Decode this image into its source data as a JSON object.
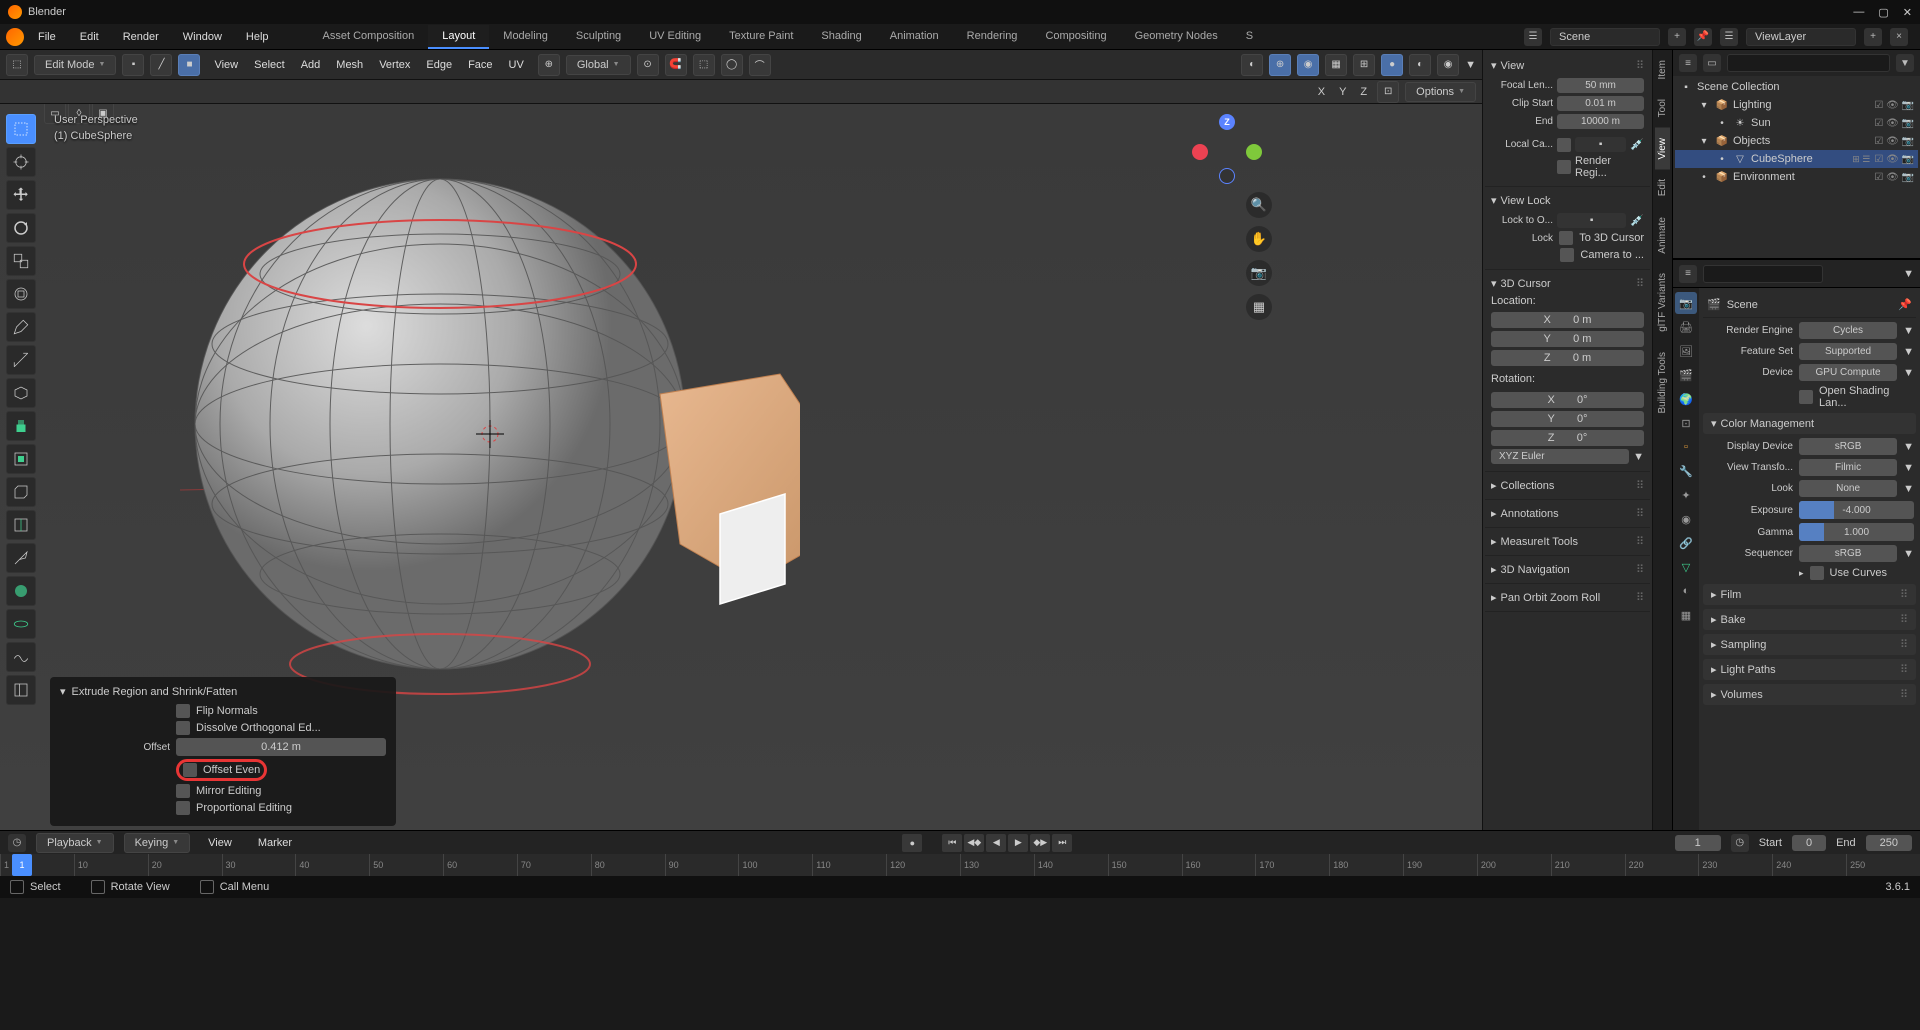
{
  "app": {
    "title": "Blender"
  },
  "menu": {
    "file": "File",
    "edit": "Edit",
    "render": "Render",
    "window": "Window",
    "help": "Help"
  },
  "workspaces": [
    "Asset Composition",
    "Layout",
    "Modeling",
    "Sculpting",
    "UV Editing",
    "Texture Paint",
    "Shading",
    "Animation",
    "Rendering",
    "Compositing",
    "Geometry Nodes",
    "S"
  ],
  "active_workspace": "Layout",
  "scene": {
    "name": "Scene",
    "layer": "ViewLayer"
  },
  "header3d": {
    "mode": "Edit Mode",
    "menus": [
      "View",
      "Select",
      "Add",
      "Mesh",
      "Vertex",
      "Edge",
      "Face",
      "UV"
    ],
    "orientation": "Global",
    "options": "Options"
  },
  "axes_header": [
    "X",
    "Y",
    "Z"
  ],
  "overlay": {
    "line1": "User Perspective",
    "line2": "(1) CubeSphere"
  },
  "op_panel": {
    "title": "Extrude Region and Shrink/Fatten",
    "flip_normals": "Flip Normals",
    "dissolve": "Dissolve Orthogonal Ed...",
    "offset_label": "Offset",
    "offset_value": "0.412 m",
    "offset_even": "Offset Even",
    "mirror": "Mirror Editing",
    "proportional": "Proportional Editing"
  },
  "npanel": {
    "tabs": [
      "Item",
      "Tool",
      "View",
      "Edit",
      "Animate",
      "glTF Variants",
      "Building Tools"
    ],
    "active_tab": "View",
    "view": {
      "title": "View",
      "focal": "Focal Len...",
      "focal_v": "50 mm",
      "clip_start": "Clip Start",
      "clip_start_v": "0.01 m",
      "end": "End",
      "end_v": "10000 m",
      "local_cam": "Local Ca...",
      "render_region": "Render Regi..."
    },
    "view_lock": {
      "title": "View Lock",
      "lock_to": "Lock to O...",
      "lock_label": "Lock",
      "to_cursor": "To 3D Cursor",
      "cam_to": "Camera to ..."
    },
    "cursor": {
      "title": "3D Cursor",
      "location": "Location:",
      "rotation": "Rotation:",
      "xyz": [
        "X",
        "Y",
        "Z"
      ],
      "loc_vals": [
        "0 m",
        "0 m",
        "0 m"
      ],
      "rot_vals": [
        "0°",
        "0°",
        "0°"
      ],
      "mode": "XYZ Euler"
    },
    "collapsed": [
      "Collections",
      "Annotations",
      "MeasureIt Tools",
      "3D Navigation",
      "Pan Orbit Zoom Roll"
    ]
  },
  "outliner": {
    "root": "Scene Collection",
    "items": [
      {
        "label": "Lighting",
        "depth": 1,
        "expanded": true,
        "icon": "📦",
        "toggles": true
      },
      {
        "label": "Sun",
        "depth": 2,
        "icon": "☀",
        "toggles": true
      },
      {
        "label": "Objects",
        "depth": 1,
        "expanded": true,
        "icon": "📦",
        "toggles": true
      },
      {
        "label": "CubeSphere",
        "depth": 2,
        "icon": "▽",
        "selected": true,
        "toggles": true,
        "extra": true
      },
      {
        "label": "Environment",
        "depth": 1,
        "icon": "📦",
        "toggles": true
      }
    ]
  },
  "props": {
    "breadcrumb": "Scene",
    "render_engine_l": "Render Engine",
    "render_engine": "Cycles",
    "feature_set_l": "Feature Set",
    "feature_set": "Supported",
    "device_l": "Device",
    "device": "GPU Compute",
    "osl": "Open Shading Lan...",
    "color_mgmt": "Color Management",
    "display_device_l": "Display Device",
    "display_device": "sRGB",
    "view_transform_l": "View Transfo...",
    "view_transform": "Filmic",
    "look_l": "Look",
    "look": "None",
    "exposure_l": "Exposure",
    "exposure": "-4.000",
    "gamma_l": "Gamma",
    "gamma": "1.000",
    "sequencer_l": "Sequencer",
    "sequencer": "sRGB",
    "use_curves": "Use Curves",
    "collapsed": [
      "Film",
      "Bake",
      "Sampling",
      "Light Paths",
      "Volumes"
    ]
  },
  "timeline": {
    "playback": "Playback",
    "keying": "Keying",
    "view": "View",
    "marker": "Marker",
    "current": "1",
    "start_l": "Start",
    "start": "0",
    "end_l": "End",
    "end": "250",
    "ticks": [
      1,
      10,
      20,
      30,
      40,
      50,
      60,
      70,
      80,
      90,
      100,
      110,
      120,
      130,
      140,
      150,
      160,
      170,
      180,
      190,
      200,
      210,
      220,
      230,
      240,
      250
    ]
  },
  "status": {
    "select": "Select",
    "rotate": "Rotate View",
    "call": "Call Menu",
    "version": "3.6.1"
  }
}
